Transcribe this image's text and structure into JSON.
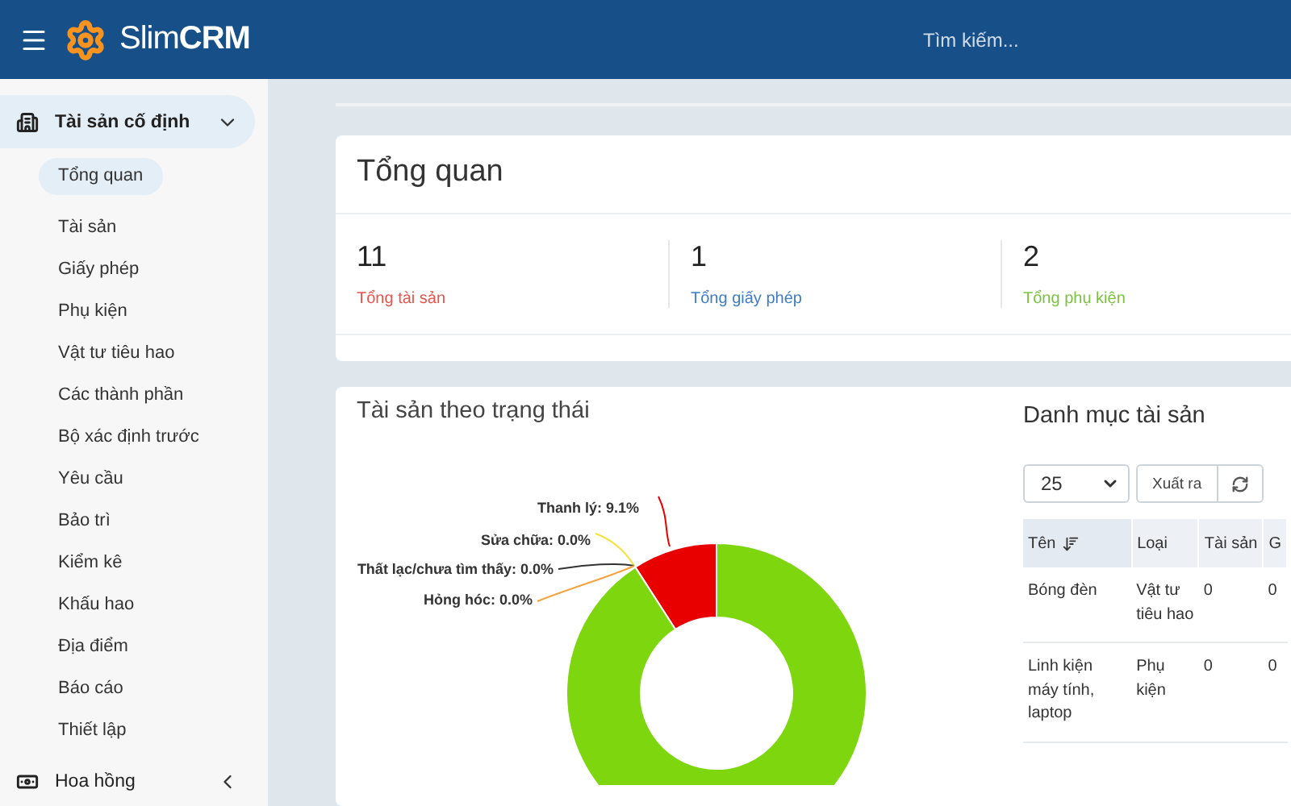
{
  "header": {
    "brand_light": "Slim",
    "brand_bold": "CRM",
    "search": {
      "placeholder": "Tìm kiếm..."
    }
  },
  "sidebar": {
    "section": {
      "label": "Tài sản cố định",
      "expanded": true
    },
    "items": [
      {
        "label": "Tổng quan",
        "selected": true
      },
      {
        "label": "Tài sản",
        "selected": false
      },
      {
        "label": "Giấy phép",
        "selected": false
      },
      {
        "label": "Phụ kiện",
        "selected": false
      },
      {
        "label": "Vật tư tiêu hao",
        "selected": false
      },
      {
        "label": "Các thành phần",
        "selected": false
      },
      {
        "label": "Bộ xác định trước",
        "selected": false
      },
      {
        "label": "Yêu cầu",
        "selected": false
      },
      {
        "label": "Bảo trì",
        "selected": false
      },
      {
        "label": "Kiểm kê",
        "selected": false
      },
      {
        "label": "Khấu hao",
        "selected": false
      },
      {
        "label": "Địa điểm",
        "selected": false
      },
      {
        "label": "Báo cáo",
        "selected": false
      },
      {
        "label": "Thiết lập",
        "selected": false
      }
    ],
    "next_section": {
      "label": "Hoa hồng",
      "expanded": false
    }
  },
  "overview": {
    "title": "Tổng quan",
    "stats": [
      {
        "value": "11",
        "label": "Tổng tài sản",
        "color": "#e5534b"
      },
      {
        "value": "1",
        "label": "Tổng giấy phép",
        "color": "#3f7cc4"
      },
      {
        "value": "2",
        "label": "Tổng phụ kiện",
        "color": "#7cc242"
      }
    ]
  },
  "status_chart": {
    "title": "Tài sản theo trạng thái",
    "chart_data": {
      "type": "donut",
      "data_labels": true,
      "value_labels": [
        "Thanh lý: 9.1%",
        "Sửa chữa: 0.0%",
        "Thất lạc/chưa tìm thấy: 0.0%",
        "Hỏng hóc: 0.0%",
        null
      ],
      "values": [
        9.1,
        0.0,
        0.0,
        0.0,
        90.9
      ],
      "colors": [
        "#e80000",
        "#f5e23a",
        "#333333",
        "#f5a340",
        "#7ed60f"
      ]
    }
  },
  "categories": {
    "title": "Danh mục tài sản",
    "page_size": "25",
    "export": "Xuất ra",
    "columns": [
      {
        "label": "Tên",
        "sorted": true
      },
      {
        "label": "Loại",
        "sorted": false
      },
      {
        "label": "Tài sản",
        "sorted": false
      },
      {
        "label": "G",
        "sorted": false
      }
    ],
    "rows": [
      [
        "Bóng đèn",
        "Vật tư tiêu hao",
        "0",
        "0"
      ],
      [
        "Linh kiện máy tính, laptop",
        "Phụ kiện",
        "0",
        "0"
      ]
    ]
  }
}
